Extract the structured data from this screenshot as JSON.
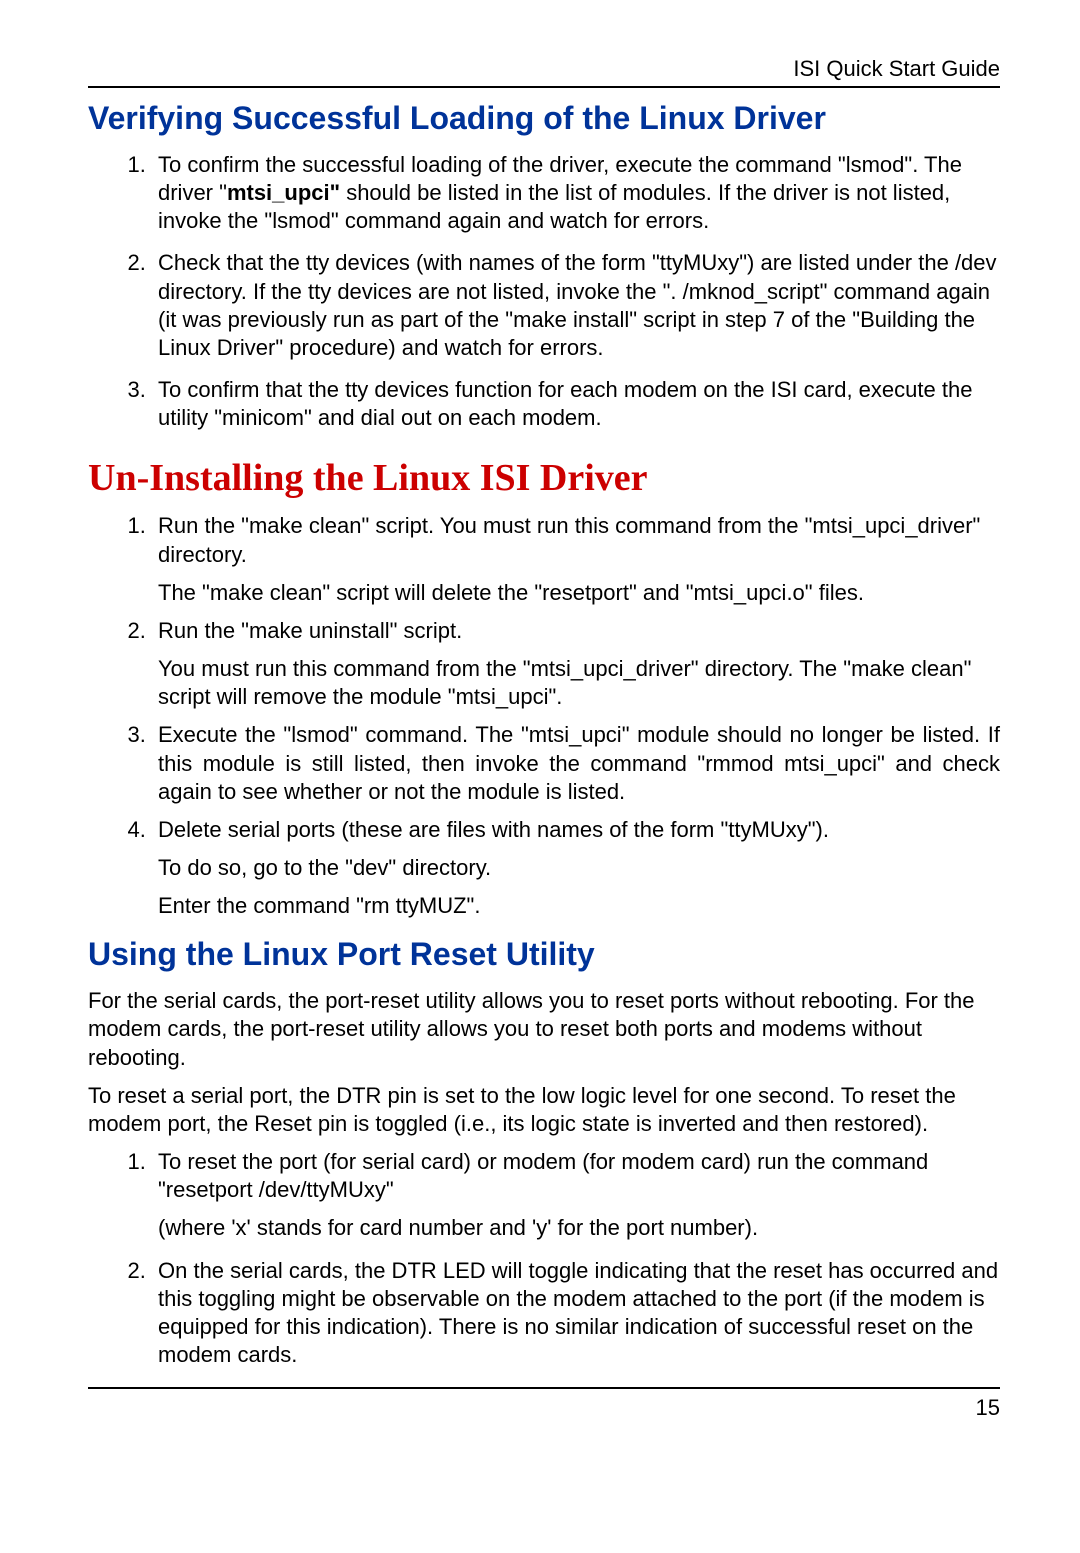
{
  "header": {
    "title": "ISI Quick Start Guide"
  },
  "section1": {
    "heading": "Verifying Successful Loading of the Linux Driver",
    "items": [
      {
        "pre": "To confirm the successful loading of the driver, execute the command \"lsmod\". The driver \"",
        "bold": "mtsi_upci\"",
        "post": " should be listed in the list of modules. If the driver is not listed, invoke the \"lsmod\" command again and watch for errors."
      },
      {
        "text": "Check that the tty devices (with names of the form \"ttyMUxy\") are listed under the /dev directory. If the tty devices are not listed, invoke the \". /mknod_script\" command again (it was previously run as part of the \"make install\" script in step 7 of the \"Building the Linux Driver\" procedure) and watch for errors."
      },
      {
        "text": "To confirm that the tty devices function for each modem on the ISI card, execute the utility \"minicom\" and dial out on each modem."
      }
    ]
  },
  "section2": {
    "heading": "Un-Installing the Linux ISI Driver",
    "items": [
      {
        "line1": "Run the \"make clean\" script. You must run this command from the \"mtsi_upci_driver\" directory.",
        "line2": "The \"make clean\" script will delete the \"resetport\" and \"mtsi_upci.o\" files."
      },
      {
        "line1": "Run the \"make uninstall\" script.",
        "line2": "You must run this command from the \"mtsi_upci_driver\" directory. The \"make clean\" script will remove the module \"mtsi_upci\"."
      },
      {
        "line1": "Execute the \"lsmod\" command. The \"mtsi_upci\" module should no longer be listed. If this module is still listed, then invoke the command \"rmmod mtsi_upci\" and check again to see whether or not the module is listed."
      },
      {
        "line1": "Delete serial ports (these are files with names of the form \"ttyMUxy\").",
        "line2": "To do so, go to the \"dev\" directory.",
        "line3": "Enter the command \"rm ttyMUZ\"."
      }
    ]
  },
  "section3": {
    "heading": "Using the Linux Port Reset Utility",
    "p1": "For the serial cards, the port-reset utility allows you to reset ports without rebooting.  For the modem cards, the port-reset utility allows you to reset both ports and modems without rebooting.",
    "p2": "To reset a serial port, the DTR pin is set to the low logic level for one second. To reset the modem port, the Reset pin is toggled (i.e., its logic state is inverted and then restored).",
    "items": [
      {
        "line1": "To reset the port (for serial card) or modem (for modem card) run the command \"resetport /dev/ttyMUxy\"",
        "line2": "(where 'x' stands for card number and 'y' for the port number)."
      },
      {
        "line1": "On the serial cards, the DTR LED will toggle indicating that the reset has occurred and this toggling might be observable on the modem attached to the port (if the modem is equipped for this indication). There is no similar indication of successful reset on the modem cards."
      }
    ]
  },
  "footer": {
    "page": "15"
  }
}
